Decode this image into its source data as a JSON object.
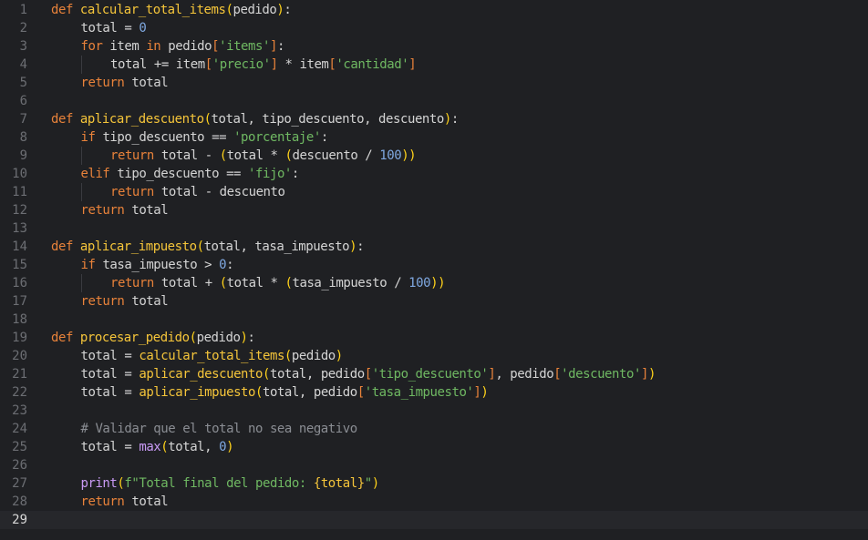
{
  "editor": {
    "language": "python",
    "active_line": 29,
    "colors": {
      "background": "#1f2023",
      "keyword": "#e8823a",
      "function": "#f5c53a",
      "string": "#6fb862",
      "number": "#7fa8e0",
      "comment": "#8a8d93",
      "builtin": "#c99af5"
    }
  },
  "lines": [
    {
      "n": "1",
      "indent": 0,
      "tokens": [
        {
          "t": "def",
          "c": "kw"
        },
        {
          "t": " "
        },
        {
          "t": "calcular_total_items",
          "c": "fn"
        },
        {
          "t": "(",
          "c": "paren"
        },
        {
          "t": "pedido"
        },
        {
          "t": ")",
          "c": "paren"
        },
        {
          "t": ":"
        }
      ]
    },
    {
      "n": "2",
      "indent": 1,
      "tokens": [
        {
          "t": "total = "
        },
        {
          "t": "0",
          "c": "num"
        }
      ]
    },
    {
      "n": "3",
      "indent": 1,
      "tokens": [
        {
          "t": "for",
          "c": "kw"
        },
        {
          "t": " item "
        },
        {
          "t": "in",
          "c": "kw"
        },
        {
          "t": " pedido"
        },
        {
          "t": "[",
          "c": "br"
        },
        {
          "t": "'items'",
          "c": "str"
        },
        {
          "t": "]",
          "c": "br"
        },
        {
          "t": ":"
        }
      ]
    },
    {
      "n": "4",
      "indent": 2,
      "tokens": [
        {
          "t": "total += item"
        },
        {
          "t": "[",
          "c": "br"
        },
        {
          "t": "'precio'",
          "c": "str"
        },
        {
          "t": "]",
          "c": "br"
        },
        {
          "t": " * item"
        },
        {
          "t": "[",
          "c": "br"
        },
        {
          "t": "'cantidad'",
          "c": "str"
        },
        {
          "t": "]",
          "c": "br"
        }
      ]
    },
    {
      "n": "5",
      "indent": 1,
      "tokens": [
        {
          "t": "return",
          "c": "kw"
        },
        {
          "t": " total"
        }
      ]
    },
    {
      "n": "6",
      "indent": 0,
      "tokens": []
    },
    {
      "n": "7",
      "indent": 0,
      "tokens": [
        {
          "t": "def",
          "c": "kw"
        },
        {
          "t": " "
        },
        {
          "t": "aplicar_descuento",
          "c": "fn"
        },
        {
          "t": "(",
          "c": "paren"
        },
        {
          "t": "total, tipo_descuento, descuento"
        },
        {
          "t": ")",
          "c": "paren"
        },
        {
          "t": ":"
        }
      ]
    },
    {
      "n": "8",
      "indent": 1,
      "tokens": [
        {
          "t": "if",
          "c": "kw"
        },
        {
          "t": " tipo_descuento == "
        },
        {
          "t": "'porcentaje'",
          "c": "str"
        },
        {
          "t": ":"
        }
      ]
    },
    {
      "n": "9",
      "indent": 2,
      "tokens": [
        {
          "t": "return",
          "c": "kw"
        },
        {
          "t": " total - "
        },
        {
          "t": "(",
          "c": "paren"
        },
        {
          "t": "total * "
        },
        {
          "t": "(",
          "c": "paren"
        },
        {
          "t": "descuento / "
        },
        {
          "t": "100",
          "c": "num"
        },
        {
          "t": "))",
          "c": "paren"
        }
      ]
    },
    {
      "n": "10",
      "indent": 1,
      "tokens": [
        {
          "t": "elif",
          "c": "kw"
        },
        {
          "t": " tipo_descuento == "
        },
        {
          "t": "'fijo'",
          "c": "str"
        },
        {
          "t": ":"
        }
      ]
    },
    {
      "n": "11",
      "indent": 2,
      "tokens": [
        {
          "t": "return",
          "c": "kw"
        },
        {
          "t": " total - descuento"
        }
      ]
    },
    {
      "n": "12",
      "indent": 1,
      "tokens": [
        {
          "t": "return",
          "c": "kw"
        },
        {
          "t": " total"
        }
      ]
    },
    {
      "n": "13",
      "indent": 0,
      "tokens": []
    },
    {
      "n": "14",
      "indent": 0,
      "tokens": [
        {
          "t": "def",
          "c": "kw"
        },
        {
          "t": " "
        },
        {
          "t": "aplicar_impuesto",
          "c": "fn"
        },
        {
          "t": "(",
          "c": "paren"
        },
        {
          "t": "total, tasa_impuesto"
        },
        {
          "t": ")",
          "c": "paren"
        },
        {
          "t": ":"
        }
      ]
    },
    {
      "n": "15",
      "indent": 1,
      "tokens": [
        {
          "t": "if",
          "c": "kw"
        },
        {
          "t": " tasa_impuesto > "
        },
        {
          "t": "0",
          "c": "num"
        },
        {
          "t": ":"
        }
      ]
    },
    {
      "n": "16",
      "indent": 2,
      "tokens": [
        {
          "t": "return",
          "c": "kw"
        },
        {
          "t": " total + "
        },
        {
          "t": "(",
          "c": "paren"
        },
        {
          "t": "total * "
        },
        {
          "t": "(",
          "c": "paren"
        },
        {
          "t": "tasa_impuesto / "
        },
        {
          "t": "100",
          "c": "num"
        },
        {
          "t": "))",
          "c": "paren"
        }
      ]
    },
    {
      "n": "17",
      "indent": 1,
      "tokens": [
        {
          "t": "return",
          "c": "kw"
        },
        {
          "t": " total"
        }
      ]
    },
    {
      "n": "18",
      "indent": 0,
      "tokens": []
    },
    {
      "n": "19",
      "indent": 0,
      "tokens": [
        {
          "t": "def",
          "c": "kw"
        },
        {
          "t": " "
        },
        {
          "t": "procesar_pedido",
          "c": "fn"
        },
        {
          "t": "(",
          "c": "paren"
        },
        {
          "t": "pedido"
        },
        {
          "t": ")",
          "c": "paren"
        },
        {
          "t": ":"
        }
      ]
    },
    {
      "n": "20",
      "indent": 1,
      "tokens": [
        {
          "t": "total = "
        },
        {
          "t": "calcular_total_items",
          "c": "fn"
        },
        {
          "t": "(",
          "c": "paren"
        },
        {
          "t": "pedido"
        },
        {
          "t": ")",
          "c": "paren"
        }
      ]
    },
    {
      "n": "21",
      "indent": 1,
      "tokens": [
        {
          "t": "total = "
        },
        {
          "t": "aplicar_descuento",
          "c": "fn"
        },
        {
          "t": "(",
          "c": "paren"
        },
        {
          "t": "total, pedido"
        },
        {
          "t": "[",
          "c": "br"
        },
        {
          "t": "'tipo_descuento'",
          "c": "str"
        },
        {
          "t": "]",
          "c": "br"
        },
        {
          "t": ", pedido"
        },
        {
          "t": "[",
          "c": "br"
        },
        {
          "t": "'descuento'",
          "c": "str"
        },
        {
          "t": "]",
          "c": "br"
        },
        {
          "t": ")",
          "c": "paren"
        }
      ]
    },
    {
      "n": "22",
      "indent": 1,
      "tokens": [
        {
          "t": "total = "
        },
        {
          "t": "aplicar_impuesto",
          "c": "fn"
        },
        {
          "t": "(",
          "c": "paren"
        },
        {
          "t": "total, pedido"
        },
        {
          "t": "[",
          "c": "br"
        },
        {
          "t": "'tasa_impuesto'",
          "c": "str"
        },
        {
          "t": "]",
          "c": "br"
        },
        {
          "t": ")",
          "c": "paren"
        }
      ]
    },
    {
      "n": "23",
      "indent": 0,
      "tokens": []
    },
    {
      "n": "24",
      "indent": 1,
      "tokens": [
        {
          "t": "# Validar que el total no sea negativo",
          "c": "com"
        }
      ]
    },
    {
      "n": "25",
      "indent": 1,
      "tokens": [
        {
          "t": "total = "
        },
        {
          "t": "max",
          "c": "bi"
        },
        {
          "t": "(",
          "c": "paren"
        },
        {
          "t": "total, "
        },
        {
          "t": "0",
          "c": "num"
        },
        {
          "t": ")",
          "c": "paren"
        }
      ]
    },
    {
      "n": "26",
      "indent": 0,
      "tokens": []
    },
    {
      "n": "27",
      "indent": 1,
      "tokens": [
        {
          "t": "print",
          "c": "bi"
        },
        {
          "t": "(",
          "c": "paren"
        },
        {
          "t": "f\"Total final del pedido: ",
          "c": "str"
        },
        {
          "t": "{total}",
          "c": "interp"
        },
        {
          "t": "\"",
          "c": "str"
        },
        {
          "t": ")",
          "c": "paren"
        }
      ]
    },
    {
      "n": "28",
      "indent": 1,
      "tokens": [
        {
          "t": "return",
          "c": "kw"
        },
        {
          "t": " total"
        }
      ]
    },
    {
      "n": "29",
      "indent": 0,
      "tokens": []
    }
  ]
}
